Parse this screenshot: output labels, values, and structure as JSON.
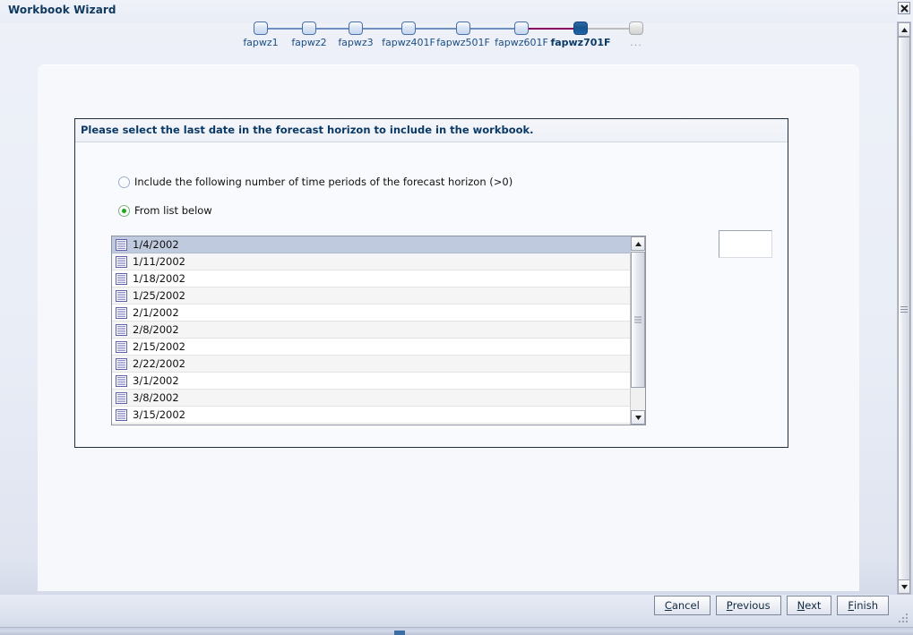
{
  "window": {
    "title": "Workbook Wizard",
    "close_icon": "close-icon"
  },
  "steps": [
    {
      "label": "fapwz1",
      "state": "done"
    },
    {
      "label": "fapwz2",
      "state": "done"
    },
    {
      "label": "fapwz3",
      "state": "done"
    },
    {
      "label": "fapwz401F",
      "state": "done"
    },
    {
      "label": "fapwz501F",
      "state": "done"
    },
    {
      "label": "fapwz601F",
      "state": "done"
    },
    {
      "label": "fapwz701F",
      "state": "current"
    },
    {
      "label": "...",
      "state": "future"
    }
  ],
  "colors": {
    "accent_line": "#8c0066",
    "step_line": "#6d8fc4",
    "muted_line": "#bdbdbd",
    "active_node": "#17548f",
    "title_text": "#10395e",
    "selection": "#bfcade",
    "radio_selected": "#21a621"
  },
  "groupbox": {
    "title": "Please select the last date in the forecast horizon to include in the workbook."
  },
  "options": {
    "periods": {
      "label": "Include the following number of time periods of the forecast horizon (>0)",
      "selected": false
    },
    "from_list": {
      "label": "From list below",
      "selected": true
    }
  },
  "periods_input": {
    "value": "",
    "placeholder": ""
  },
  "date_list": {
    "selected_index": 0,
    "items": [
      "1/4/2002",
      "1/11/2002",
      "1/18/2002",
      "1/25/2002",
      "2/1/2002",
      "2/8/2002",
      "2/15/2002",
      "2/22/2002",
      "3/1/2002",
      "3/8/2002",
      "3/15/2002"
    ]
  },
  "scrollbars": {
    "list_up_icon": "chevron-up-icon",
    "list_down_icon": "chevron-down-icon",
    "main_up_icon": "chevron-up-icon",
    "main_down_icon": "chevron-down-icon"
  },
  "buttons": {
    "cancel": {
      "before": "",
      "mnemonic": "C",
      "after": "ancel"
    },
    "previous": {
      "before": "",
      "mnemonic": "P",
      "after": "revious"
    },
    "next": {
      "before": "",
      "mnemonic": "N",
      "after": "ext"
    },
    "finish": {
      "before": "",
      "mnemonic": "F",
      "after": "inish"
    }
  }
}
